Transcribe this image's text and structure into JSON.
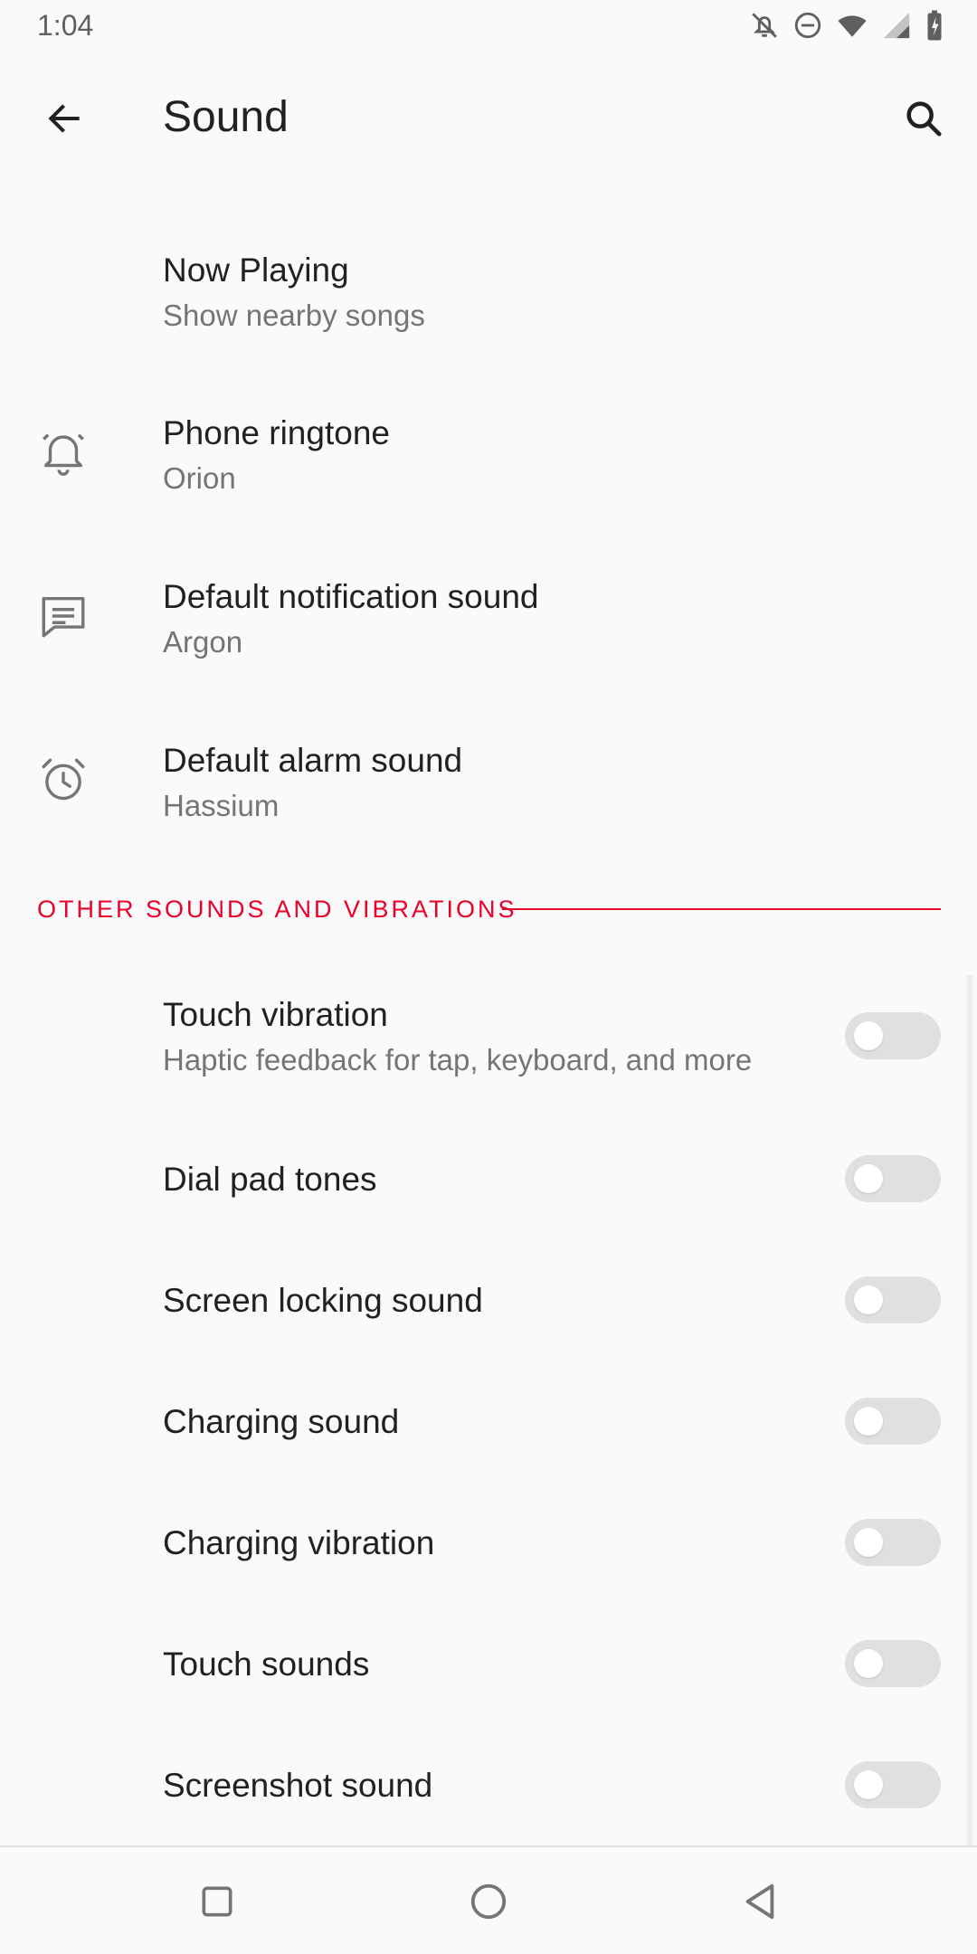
{
  "status_bar": {
    "time": "1:04",
    "icons": [
      "notifications-off-icon",
      "do-not-disturb-icon",
      "wifi-icon",
      "signal-icon",
      "battery-charging-icon"
    ]
  },
  "app_bar": {
    "title": "Sound",
    "back_icon": "arrow-back-icon",
    "search_icon": "search-icon"
  },
  "items": [
    {
      "title": "Now Playing",
      "subtitle": "Show nearby songs",
      "icon": null
    },
    {
      "title": "Phone ringtone",
      "subtitle": "Orion",
      "icon": "bell-icon"
    },
    {
      "title": "Default notification sound",
      "subtitle": "Argon",
      "icon": "message-icon"
    },
    {
      "title": "Default alarm sound",
      "subtitle": "Hassium",
      "icon": "alarm-clock-icon"
    }
  ],
  "section": {
    "header": "OTHER SOUNDS AND VIBRATIONS",
    "accent_color": "#EB0028"
  },
  "toggles": [
    {
      "title": "Touch vibration",
      "subtitle": "Haptic feedback for tap, keyboard, and more",
      "on": false
    },
    {
      "title": "Dial pad tones",
      "on": false
    },
    {
      "title": "Screen locking sound",
      "on": false
    },
    {
      "title": "Charging sound",
      "on": false
    },
    {
      "title": "Charging vibration",
      "on": false
    },
    {
      "title": "Touch sounds",
      "on": false
    },
    {
      "title": "Screenshot sound",
      "on": false
    }
  ],
  "nav_bar": {
    "buttons": [
      "recents-square-icon",
      "home-circle-icon",
      "back-triangle-icon"
    ]
  }
}
